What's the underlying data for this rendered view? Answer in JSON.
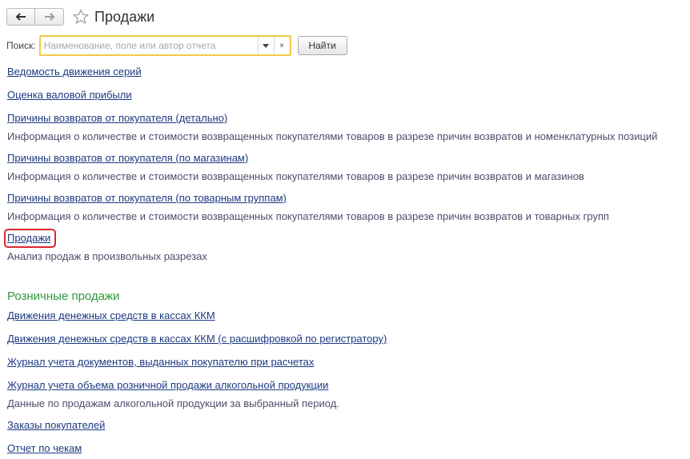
{
  "header": {
    "title": "Продажи"
  },
  "search": {
    "label": "Поиск:",
    "placeholder": "Наименование, поле или автор отчета",
    "value": "",
    "find_button": "Найти"
  },
  "reports": [
    {
      "title": "Ведомость движения серий",
      "description": ""
    },
    {
      "title": "Оценка валовой прибыли",
      "description": ""
    },
    {
      "title": "Причины возвратов от покупателя (детально)",
      "description": "Информация о количестве и стоимости возвращенных покупателями товаров в разрезе причин возвратов и номенклатурных позиций"
    },
    {
      "title": "Причины возвратов от покупателя (по магазинам)",
      "description": "Информация о количестве и стоимости возвращенных покупателями товаров в разрезе причин возвратов и магазинов"
    },
    {
      "title": "Причины возвратов от покупателя (по товарным группам)",
      "description": "Информация о количестве и стоимости возвращенных покупателями товаров в разрезе причин возвратов и товарных групп"
    },
    {
      "title": "Продажи",
      "description": "Анализ продаж в произвольных разрезах"
    }
  ],
  "retail_section": {
    "title": "Розничные продажи",
    "reports": [
      {
        "title": "Движения денежных средств в кассах ККМ",
        "description": ""
      },
      {
        "title": "Движения денежных средств в кассах ККМ (с расшифровкой по регистратору)",
        "description": ""
      },
      {
        "title": "Журнал учета документов, выданных покупателю при расчетах",
        "description": ""
      },
      {
        "title": "Журнал учета объема розничной продажи алкогольной продукции",
        "description": "Данные по продажам алкогольной продукции за выбранный период."
      },
      {
        "title": "Заказы покупателей",
        "description": ""
      },
      {
        "title": "Отчет по чекам",
        "description": ""
      }
    ]
  },
  "colors": {
    "link": "#1c3a82",
    "section_title": "#2e9a3a",
    "highlight": "#e0262c",
    "search_focus": "#f2c94c"
  },
  "icons": [
    "back-arrow-icon",
    "forward-arrow-icon",
    "favorite-star-icon",
    "dropdown-arrow-icon",
    "clear-icon"
  ]
}
